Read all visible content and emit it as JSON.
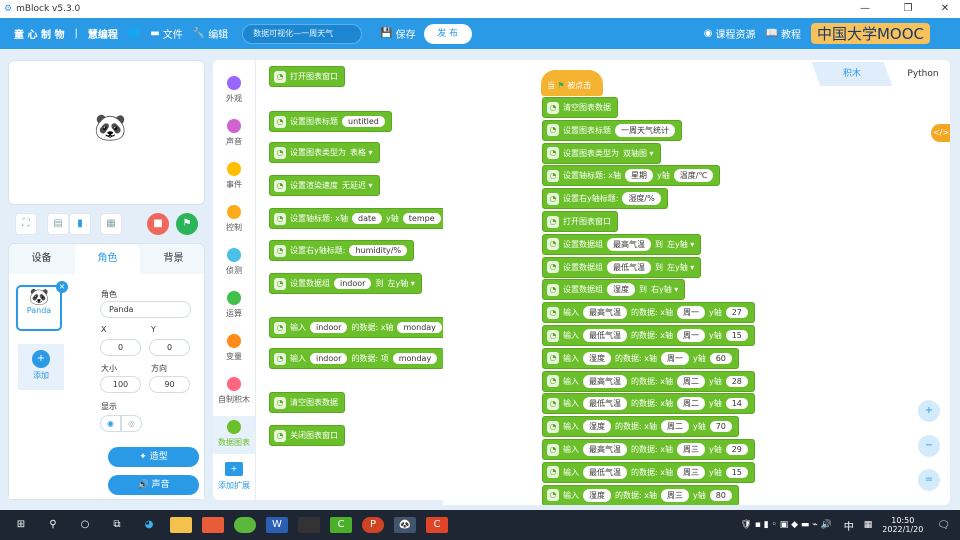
{
  "window": {
    "title": "mBlock v5.3.0"
  },
  "menu": {
    "brand": "童 心 制 物",
    "sep": "|",
    "brand2": "慧编程",
    "file": "文件",
    "edit": "编辑",
    "project_name": "数据可视化—一周天气",
    "save": "保存",
    "publish": "发 布",
    "courses": "课程资源",
    "tutorial": "教程",
    "watermark": "中国大学MOOC"
  },
  "stage_tools": {
    "fullscreen": "⛶",
    "layout_small": "▤",
    "layout_large": "▮",
    "grid": "▦",
    "stop": "■",
    "go": "⚑"
  },
  "sprite_panel": {
    "tabs": [
      "设备",
      "角色",
      "背景"
    ],
    "active_tab": 1,
    "sprite_name": "Panda",
    "add_label": "添加",
    "role_label": "角色",
    "role_value": "Panda",
    "x_label": "X",
    "x_value": "0",
    "y_label": "Y",
    "y_value": "0",
    "size_label": "大小",
    "size_value": "100",
    "dir_label": "方向",
    "dir_value": "90",
    "show_label": "显示",
    "costume_btn": "造型",
    "sound_btn": "声音"
  },
  "categories": [
    {
      "label": "外观",
      "color": "#9966ff"
    },
    {
      "label": "声音",
      "color": "#cf63cf"
    },
    {
      "label": "事件",
      "color": "#ffbf00"
    },
    {
      "label": "控制",
      "color": "#ffab19"
    },
    {
      "label": "侦测",
      "color": "#4cbfe6"
    },
    {
      "label": "运算",
      "color": "#40bf4a"
    },
    {
      "label": "变量",
      "color": "#ff8c1a"
    },
    {
      "label": "自制积木",
      "color": "#ff6680"
    },
    {
      "label": "数据图表",
      "color": "#6bbf2a"
    }
  ],
  "active_category": 8,
  "add_extension": "添加扩展",
  "palette_blocks": [
    [
      {
        "t": "打开图表窗口"
      }
    ],
    [
      {
        "t": "设置图表标题"
      },
      {
        "p": "untitled"
      }
    ],
    [
      {
        "t": "设置图表类型为"
      },
      {
        "d": "表格 ▾"
      }
    ],
    [
      {
        "t": "设置渲染速度"
      },
      {
        "d": "无延迟 ▾"
      }
    ],
    [
      {
        "t": "设置轴标题: x轴"
      },
      {
        "p": "date"
      },
      {
        "t": "y轴"
      },
      {
        "p": "tempe"
      }
    ],
    [
      {
        "t": "设置右y轴标题:"
      },
      {
        "p": "humidity/%"
      }
    ],
    [
      {
        "t": "设置数据组"
      },
      {
        "p": "indoor"
      },
      {
        "t": "到"
      },
      {
        "d": "左y轴 ▾"
      }
    ],
    [
      {
        "t": "输入"
      },
      {
        "p": "indoor"
      },
      {
        "t": "的数据: x轴"
      },
      {
        "p": "monday"
      }
    ],
    [
      {
        "t": "输入"
      },
      {
        "p": "indoor"
      },
      {
        "t": "的数据: 项"
      },
      {
        "p": "monday"
      }
    ],
    [
      {
        "t": "清空图表数据"
      }
    ],
    [
      {
        "t": "关闭图表窗口"
      }
    ]
  ],
  "editor_tabs": {
    "blocks": "积木",
    "python": "Python"
  },
  "hat": {
    "when": "当",
    "flag": "⚑",
    "clicked": "被点击"
  },
  "script_blocks": [
    [
      {
        "t": "清空图表数据"
      }
    ],
    [
      {
        "t": "设置图表标题"
      },
      {
        "p": "一周天气统计"
      }
    ],
    [
      {
        "t": "设置图表类型为"
      },
      {
        "d": "双轴图 ▾"
      }
    ],
    [
      {
        "t": "设置轴标题: x轴"
      },
      {
        "p": "星期"
      },
      {
        "t": "y轴"
      },
      {
        "p": "温度/℃"
      }
    ],
    [
      {
        "t": "设置右y轴标题:"
      },
      {
        "p": "湿度/%"
      }
    ],
    [
      {
        "t": "打开图表窗口"
      }
    ],
    [
      {
        "t": "设置数据组"
      },
      {
        "p": "最高气温"
      },
      {
        "t": "到"
      },
      {
        "d": "左y轴 ▾"
      }
    ],
    [
      {
        "t": "设置数据组"
      },
      {
        "p": "最低气温"
      },
      {
        "t": "到"
      },
      {
        "d": "左y轴 ▾"
      }
    ],
    [
      {
        "t": "设置数据组"
      },
      {
        "p": "湿度"
      },
      {
        "t": "到"
      },
      {
        "d": "右y轴 ▾"
      }
    ],
    [
      {
        "t": "输入"
      },
      {
        "p": "最高气温"
      },
      {
        "t": "的数据: x轴"
      },
      {
        "p": "周一"
      },
      {
        "t": "y轴"
      },
      {
        "p": "27"
      }
    ],
    [
      {
        "t": "输入"
      },
      {
        "p": "最低气温"
      },
      {
        "t": "的数据: x轴"
      },
      {
        "p": "周一"
      },
      {
        "t": "y轴"
      },
      {
        "p": "15"
      }
    ],
    [
      {
        "t": "输入"
      },
      {
        "p": "湿度"
      },
      {
        "t": "的数据: x轴"
      },
      {
        "p": "周一"
      },
      {
        "t": "y轴"
      },
      {
        "p": "60"
      }
    ],
    [
      {
        "t": "输入"
      },
      {
        "p": "最高气温"
      },
      {
        "t": "的数据: x轴"
      },
      {
        "p": "周二"
      },
      {
        "t": "y轴"
      },
      {
        "p": "28"
      }
    ],
    [
      {
        "t": "输入"
      },
      {
        "p": "最低气温"
      },
      {
        "t": "的数据: x轴"
      },
      {
        "p": "周二"
      },
      {
        "t": "y轴"
      },
      {
        "p": "14"
      }
    ],
    [
      {
        "t": "输入"
      },
      {
        "p": "湿度"
      },
      {
        "t": "的数据: x轴"
      },
      {
        "p": "周二"
      },
      {
        "t": "y轴"
      },
      {
        "p": "70"
      }
    ],
    [
      {
        "t": "输入"
      },
      {
        "p": "最高气温"
      },
      {
        "t": "的数据: x轴"
      },
      {
        "p": "周三"
      },
      {
        "t": "y轴"
      },
      {
        "p": "29"
      }
    ],
    [
      {
        "t": "输入"
      },
      {
        "p": "最低气温"
      },
      {
        "t": "的数据: x轴"
      },
      {
        "p": "周三"
      },
      {
        "t": "y轴"
      },
      {
        "p": "15"
      }
    ],
    [
      {
        "t": "输入"
      },
      {
        "p": "湿度"
      },
      {
        "t": "的数据: x轴"
      },
      {
        "p": "周三"
      },
      {
        "t": "y轴"
      },
      {
        "p": "80"
      }
    ]
  ],
  "zoom": {
    "in": "+",
    "out": "−",
    "reset": "="
  },
  "taskbar": {
    "ime": "中",
    "time": "10:50",
    "date": "2022/1/20"
  }
}
